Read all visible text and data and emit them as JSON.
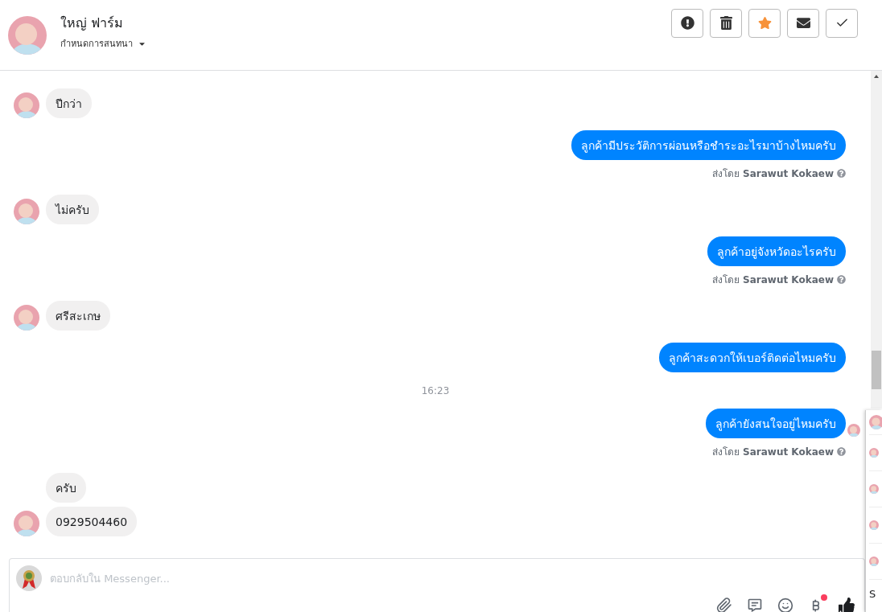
{
  "header": {
    "name": "ใหญ่ ฟาร์ม",
    "subtitle": "กำหนดการสนทนา",
    "actions": [
      {
        "kind": "alert",
        "on": false
      },
      {
        "kind": "trash",
        "on": false
      },
      {
        "kind": "star",
        "on": true
      },
      {
        "kind": "mail",
        "on": false
      },
      {
        "kind": "check",
        "on": false
      }
    ]
  },
  "messages": [
    {
      "kind": "incoming",
      "text": "ปีกว่า",
      "avatar": true
    },
    {
      "kind": "outgoing",
      "text": "ลูกค้ามีประวัติการผ่อนหรือชำระอะไรมาบ้างไหมครับ",
      "sent_by": {
        "prefix": "ส่งโดย",
        "name": "Sarawut Kokaew"
      },
      "seen": false
    },
    {
      "kind": "incoming",
      "text": "ไม่ครับ",
      "avatar": true
    },
    {
      "kind": "outgoing",
      "text": "ลูกค้าอยู่จังหวัดอะไรครับ",
      "sent_by": {
        "prefix": "ส่งโดย",
        "name": "Sarawut Kokaew"
      },
      "seen": false
    },
    {
      "kind": "incoming",
      "text": "ศรีสะเกษ",
      "avatar": true
    },
    {
      "kind": "outgoing",
      "text": "ลูกค้าสะดวกให้เบอร์ติดต่อไหมครับ",
      "seen": false
    },
    {
      "kind": "time",
      "text": "16:23"
    },
    {
      "kind": "outgoing",
      "text": "ลูกค้ายังสนใจอยู่ไหมครับ",
      "sent_by": {
        "prefix": "ส่งโดย",
        "name": "Sarawut Kokaew"
      },
      "seen": true
    },
    {
      "kind": "incoming",
      "text": "ครับ",
      "avatar": false
    },
    {
      "kind": "incoming",
      "text": "0929504460",
      "avatar": true
    }
  ],
  "composer": {
    "placeholder": "ตอบกลับใน Messenger...",
    "tools": [
      {
        "kind": "attach",
        "badge": false
      },
      {
        "kind": "chat",
        "badge": false
      },
      {
        "kind": "emoji",
        "badge": false
      },
      {
        "kind": "baht",
        "badge": true
      },
      {
        "kind": "like",
        "badge": false
      }
    ]
  },
  "side_panel": {
    "text": "S"
  }
}
